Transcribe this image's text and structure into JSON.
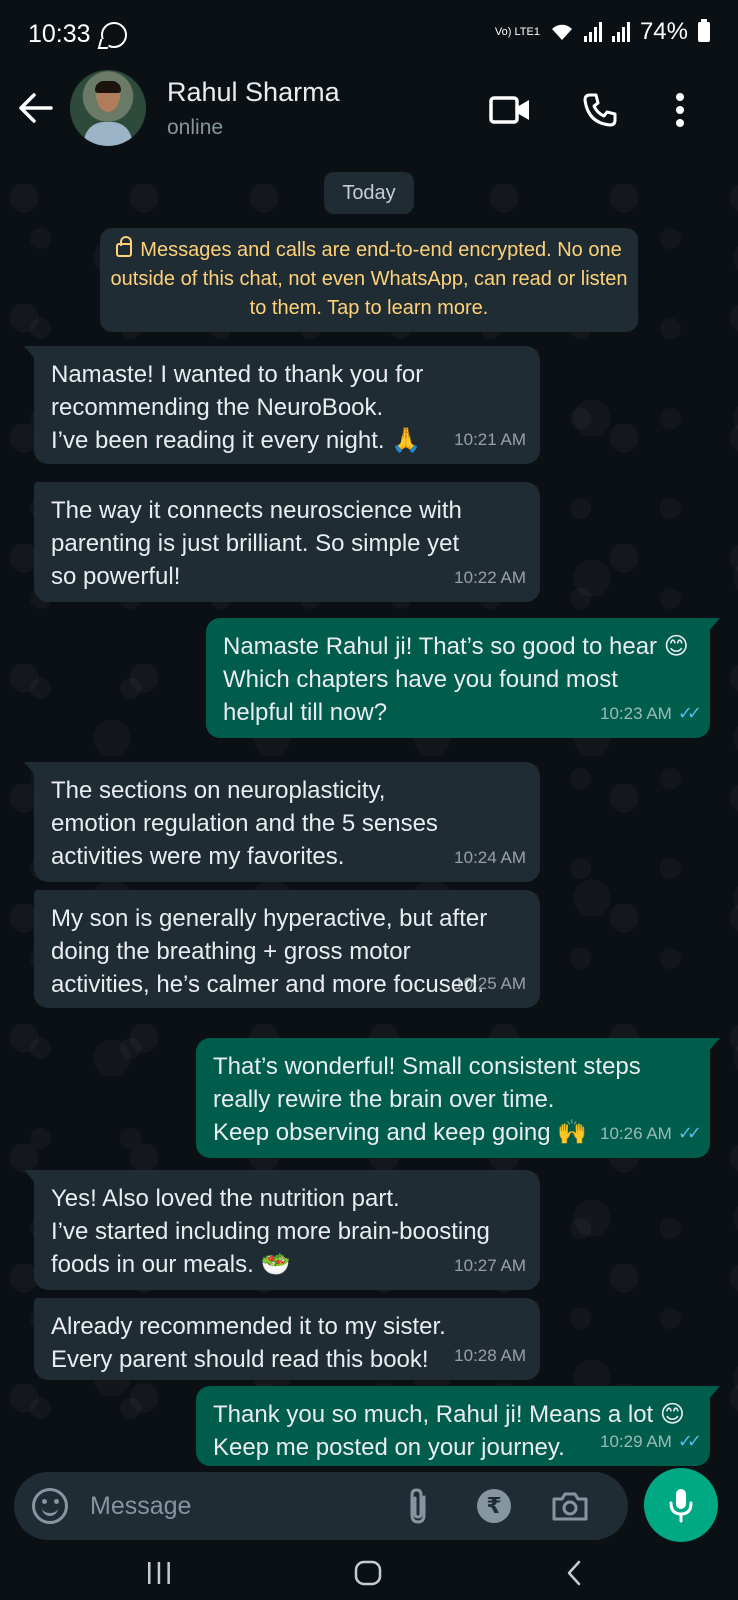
{
  "status_bar": {
    "time": "10:33",
    "network": "Vo) LTE1",
    "battery": "74%"
  },
  "header": {
    "contact_name": "Rahul Sharma",
    "contact_status": "online"
  },
  "chat": {
    "date_chip": "Today",
    "encryption_notice": "Messages and calls are end-to-end encrypted. No one outside of this chat, not even WhatsApp, can read or listen to them. Tap to learn more.",
    "messages": [
      {
        "direction": "in",
        "text": "Namaste! I wanted to thank you for\nrecommending the NeuroBook.\nI’ve been reading it every night. 🙏",
        "time": "10:21 AM"
      },
      {
        "direction": "in",
        "text": "The way it connects neuroscience with\nparenting is just brilliant. So simple yet\nso powerful!",
        "time": "10:22 AM"
      },
      {
        "direction": "out",
        "text": "Namaste Rahul ji! That’s so good to hear 😊\nWhich chapters have you found most\nhelpful till now?",
        "time": "10:23 AM",
        "read": true
      },
      {
        "direction": "in",
        "text": "The sections on neuroplasticity,\nemotion regulation and the 5 senses\nactivities were my favorites.",
        "time": "10:24 AM"
      },
      {
        "direction": "in",
        "text": "My son is generally hyperactive, but after\ndoing the breathing + gross motor\nactivities, he’s calmer and more focused.",
        "time": "10:25 AM"
      },
      {
        "direction": "out",
        "text": "That’s wonderful! Small consistent steps\nreally rewire the brain over time.\nKeep observing and keep going 🙌",
        "time": "10:26 AM",
        "read": true
      },
      {
        "direction": "in",
        "text": "Yes! Also loved the nutrition part.\nI’ve started including more brain-boosting\nfoods in our meals. 🥗",
        "time": "10:27 AM"
      },
      {
        "direction": "in",
        "text": "Already recommended it to my sister.\nEvery parent should read this book!",
        "time": "10:28 AM"
      },
      {
        "direction": "out",
        "text": "Thank you so much, Rahul ji! Means a lot 😊\nKeep me posted on your journey.",
        "time": "10:29 AM",
        "read": true
      }
    ]
  },
  "input_bar": {
    "placeholder": "Message",
    "rupee_symbol": "₹"
  },
  "colors": {
    "incoming_bubble": "#1f2c34",
    "outgoing_bubble": "#005c4b",
    "accent": "#00a884",
    "read_tick": "#53bdeb",
    "encryption_text": "#ffd279"
  }
}
